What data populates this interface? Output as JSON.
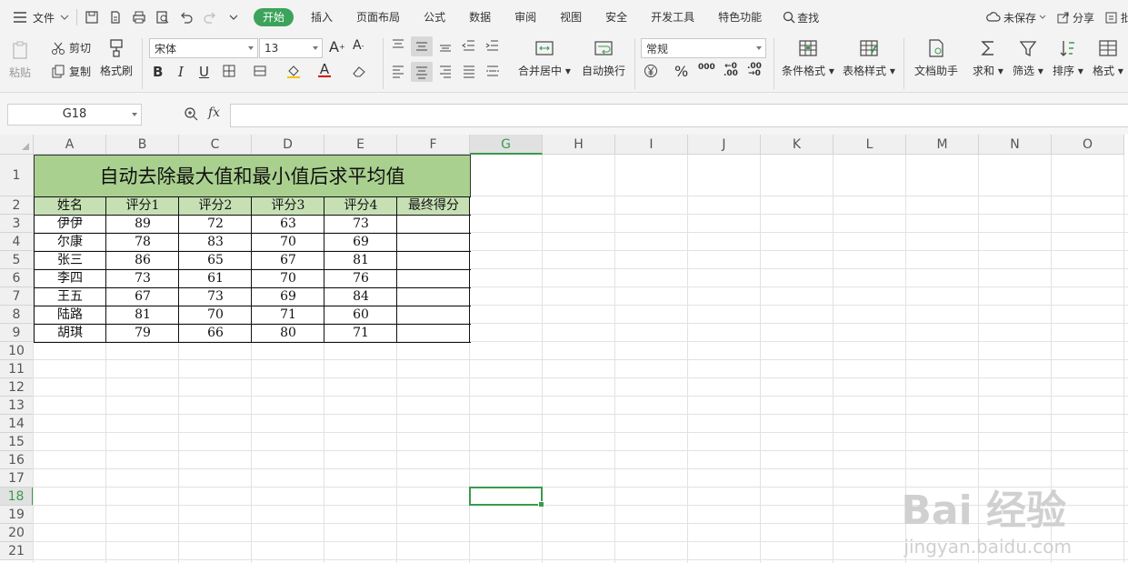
{
  "menubar": {
    "file_label": "文件",
    "tabs": [
      "开始",
      "插入",
      "页面布局",
      "公式",
      "数据",
      "审阅",
      "视图",
      "安全",
      "开发工具",
      "特色功能"
    ],
    "search_label": "查找",
    "unsaved_label": "未保存",
    "share_label": "分享",
    "batch_label": "批"
  },
  "ribbon": {
    "paste_label": "粘贴",
    "cut_label": "剪切",
    "copy_label": "复制",
    "format_painter_label": "格式刷",
    "font_name": "宋体",
    "font_size": "13",
    "merge_center_label": "合并居中",
    "wrap_text_label": "自动换行",
    "number_format": "常规",
    "conditional_format_label": "条件格式",
    "table_style_label": "表格样式",
    "doc_assistant_label": "文档助手",
    "sum_label": "求和",
    "filter_label": "筛选",
    "sort_label": "排序",
    "format_label": "格式",
    "bold": "B",
    "italic": "I",
    "underline": "U",
    "percent": "%",
    "thousands": "000",
    "inc_decimal": ".00",
    "dec_decimal": ".00",
    "font_grow": "A",
    "font_shrink": "A",
    "font_color": "A"
  },
  "formula_bar": {
    "cell_ref": "G18",
    "fx_label": "fx",
    "content": ""
  },
  "sheet": {
    "columns": [
      "A",
      "B",
      "C",
      "D",
      "E",
      "F",
      "G",
      "H",
      "I",
      "J",
      "K",
      "L",
      "M",
      "N",
      "O"
    ],
    "selected_column": "G",
    "rows": [
      "1",
      "2",
      "3",
      "4",
      "5",
      "6",
      "7",
      "8",
      "9",
      "10",
      "11",
      "12",
      "13",
      "14",
      "15",
      "16",
      "17",
      "18",
      "19",
      "20",
      "21"
    ],
    "selected_row": "18",
    "title": "自动去除最大值和最小值后求平均值",
    "headers": [
      "姓名",
      "评分1",
      "评分2",
      "评分3",
      "评分4",
      "最终得分"
    ],
    "data": [
      [
        "伊伊",
        "89",
        "72",
        "63",
        "73",
        ""
      ],
      [
        "尔康",
        "78",
        "83",
        "70",
        "69",
        ""
      ],
      [
        "张三",
        "86",
        "65",
        "67",
        "81",
        ""
      ],
      [
        "李四",
        "73",
        "61",
        "70",
        "76",
        ""
      ],
      [
        "王五",
        "67",
        "73",
        "69",
        "84",
        ""
      ],
      [
        "陆路",
        "81",
        "70",
        "71",
        "60",
        ""
      ],
      [
        "胡琪",
        "79",
        "66",
        "80",
        "71",
        ""
      ]
    ]
  },
  "watermark": {
    "brand": "Bai 经验",
    "url": "jingyan.baidu.com"
  }
}
